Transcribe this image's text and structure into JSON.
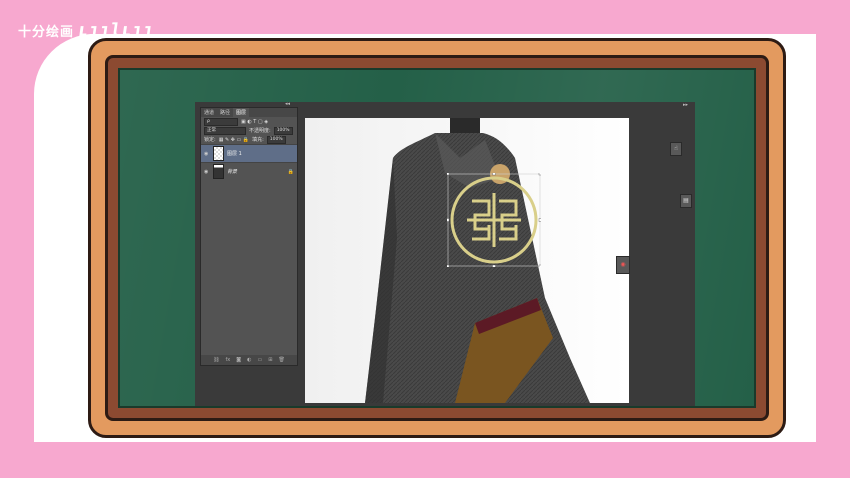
{
  "watermark": {
    "text": "十分绘画",
    "logo": "bilibili"
  },
  "photoshop": {
    "layers_panel": {
      "tabs": [
        {
          "label": "通道",
          "active": false
        },
        {
          "label": "路径",
          "active": false
        },
        {
          "label": "图层",
          "active": true
        }
      ],
      "blend_mode": "正常",
      "opacity_label": "不透明度:",
      "opacity_value": "100%",
      "lock_label": "锁定:",
      "fill_label": "填充:",
      "fill_value": "100%",
      "layers": [
        {
          "name": "图层 1",
          "selected": true
        },
        {
          "name": "背景",
          "selected": false
        }
      ]
    },
    "colors": {
      "ui_dark": "#3a3a3a",
      "panel": "#535353",
      "selection": "#5f6e88",
      "ornament_gold": "#d9cf8a"
    }
  }
}
